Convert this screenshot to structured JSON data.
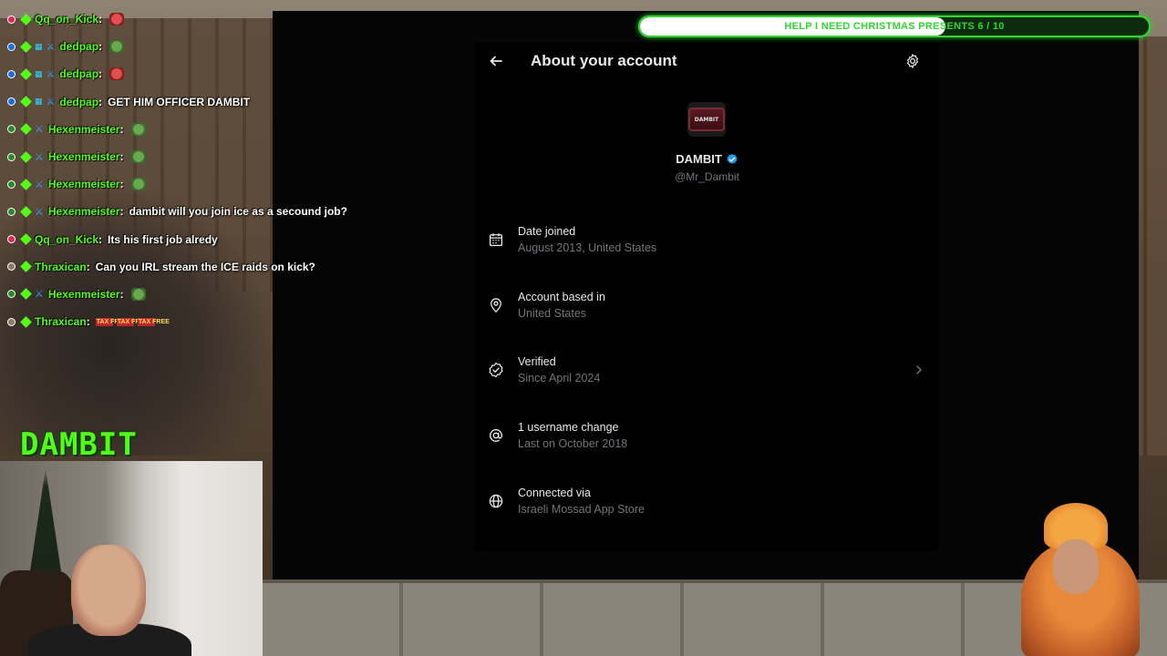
{
  "goal": {
    "label": "HELP I NEED CHRISTMAS PRESENTS 6 / 10",
    "progress": 0.6
  },
  "chat": {
    "messages": [
      {
        "user": "Qq_on_Kick",
        "text": "",
        "dot": "#e0245e",
        "sword": false,
        "box": false,
        "emote": "red"
      },
      {
        "user": "dedpap",
        "text": "",
        "dot": "#1d6fe0",
        "sword": true,
        "box": true,
        "emote": "pepe"
      },
      {
        "user": "dedpap",
        "text": "",
        "dot": "#1d6fe0",
        "sword": true,
        "box": true,
        "emote": "red"
      },
      {
        "user": "dedpap",
        "text": "GET HIM OFFICER DAMBIT",
        "dot": "#1d6fe0",
        "sword": true,
        "box": true,
        "emote": ""
      },
      {
        "user": "Hexenmeister",
        "text": "",
        "dot": "#2a8a2a",
        "sword": true,
        "box": false,
        "emote": "pepe"
      },
      {
        "user": "Hexenmeister",
        "text": "",
        "dot": "#2a8a2a",
        "sword": true,
        "box": false,
        "emote": "pepe"
      },
      {
        "user": "Hexenmeister",
        "text": "",
        "dot": "#2a8a2a",
        "sword": true,
        "box": false,
        "emote": "pepe"
      },
      {
        "user": "Hexenmeister",
        "text": "dambit will you join ice as a secound job?",
        "dot": "#2a8a2a",
        "sword": true,
        "box": false,
        "emote": ""
      },
      {
        "user": "Qq_on_Kick",
        "text": "Its his first job alredy",
        "dot": "#e0245e",
        "sword": false,
        "box": false,
        "emote": ""
      },
      {
        "user": "Thraxican",
        "text": "Can you IRL stream the ICE raids on kick?",
        "dot": "#8a7a6a",
        "sword": false,
        "box": false,
        "emote": ""
      },
      {
        "user": "Hexenmeister",
        "text": "",
        "dot": "#2a8a2a",
        "sword": true,
        "box": false,
        "emote": "pepe"
      },
      {
        "user": "Thraxican",
        "text": "",
        "dot": "#8a7a6a",
        "sword": false,
        "box": false,
        "emote": "tax"
      }
    ],
    "tax_emote_text": "TAX FREE"
  },
  "brand": "DAMBIT",
  "panel": {
    "title": "About your account",
    "avatar_text": "DAMBIT",
    "display_name": "DAMBIT",
    "handle": "@Mr_Dambit",
    "accent": "#1d9bf0",
    "rows": [
      {
        "icon": "calendar-icon",
        "label": "Date joined",
        "value": "August 2013, United States",
        "chevron": false
      },
      {
        "icon": "location-pin-icon",
        "label": "Account based in",
        "value": "United States",
        "chevron": false
      },
      {
        "icon": "verified-check-icon",
        "label": "Verified",
        "value": "Since April 2024",
        "chevron": true
      },
      {
        "icon": "at-sign-icon",
        "label": "1 username change",
        "value": "Last on October 2018",
        "chevron": false
      },
      {
        "icon": "globe-icon",
        "label": "Connected via",
        "value": "Israeli Mossad App Store",
        "chevron": false
      }
    ]
  }
}
